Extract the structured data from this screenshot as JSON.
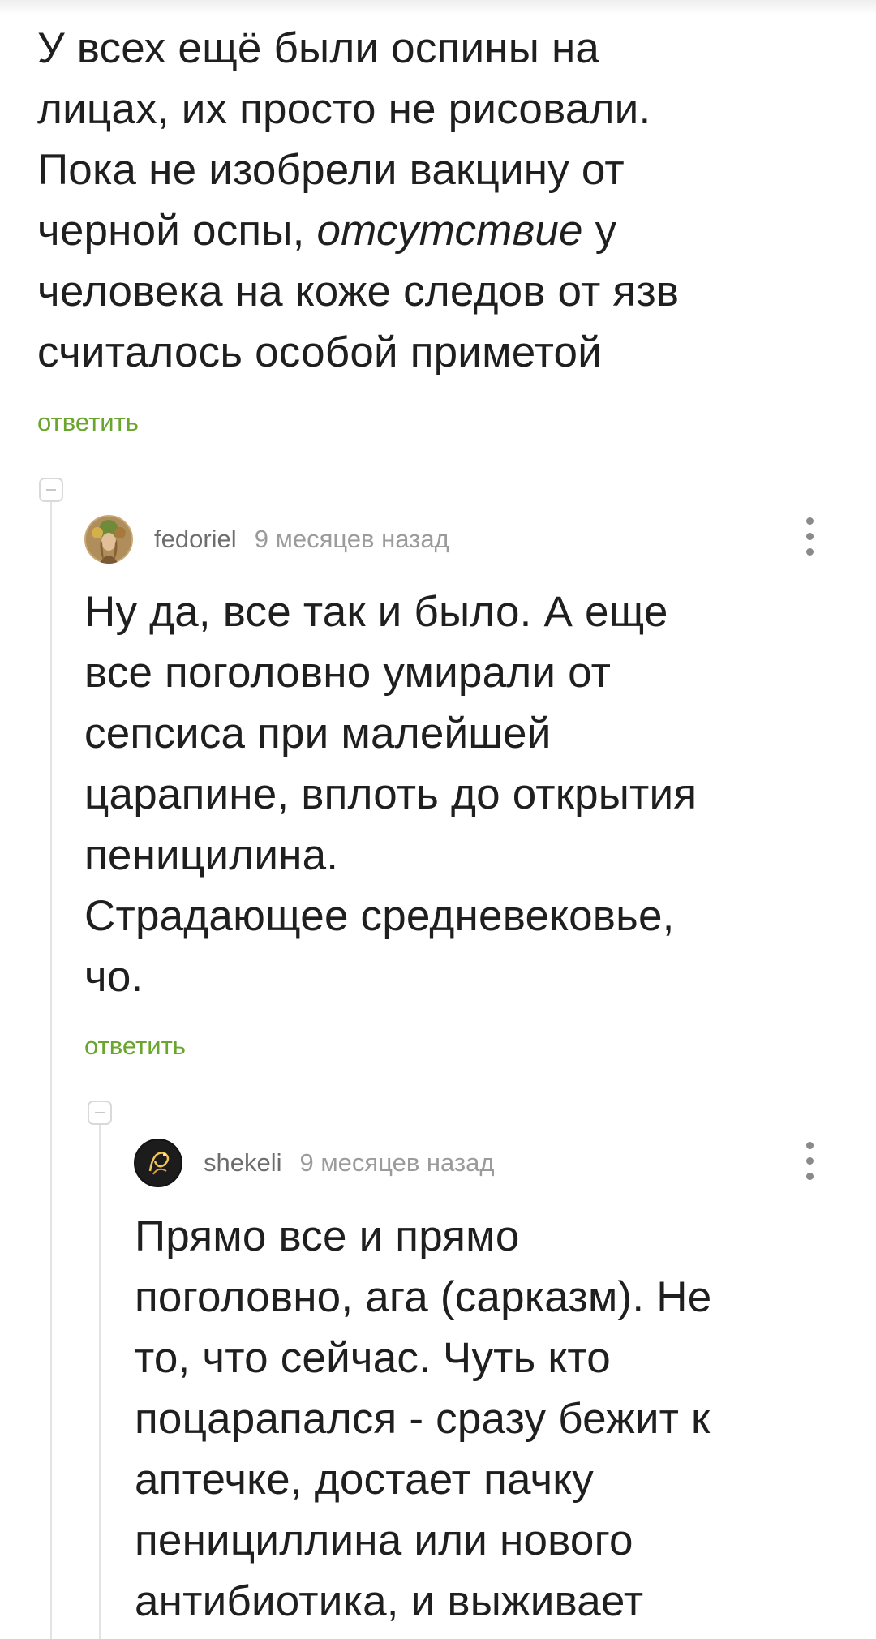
{
  "comment_parent": {
    "lines": [
      "У всех ещё были оспины на",
      "лицах, их просто не рисовали.",
      "Пока не изобрели вакцину от",
      "черной оспы, ",
      "человека на коже следов от язв",
      "считалось особой приметой"
    ],
    "italic_word": "отсутствие",
    "after_italic": " у",
    "reply_label": "ответить"
  },
  "comment_fedoriel": {
    "username": "fedoriel",
    "timestamp": "9 месяцев назад",
    "lines": [
      "Ну да, все так и было. А еще",
      "все поголовно умирали от",
      "сепсиса при малейшей",
      "царапине, вплоть до открытия",
      "пеницилина.",
      "Страдающее средневековье,",
      "чо."
    ],
    "reply_label": "ответить"
  },
  "comment_shekeli": {
    "username": "shekeli",
    "timestamp": "9 месяцев назад",
    "lines": [
      "Прямо все и прямо",
      "поголовно, ага (сарказм). Не",
      "то, что сейчас. Чуть кто",
      "поцарапался - сразу бежит к",
      "аптечке, достает пачку",
      "пенициллина или нового",
      "антибиотика, и выживает"
    ]
  },
  "colors": {
    "accent_green": "#6aa52e",
    "text": "#1f1f1f",
    "meta_gray": "#9b9b9b",
    "thread_line": "#e3e3e3"
  }
}
